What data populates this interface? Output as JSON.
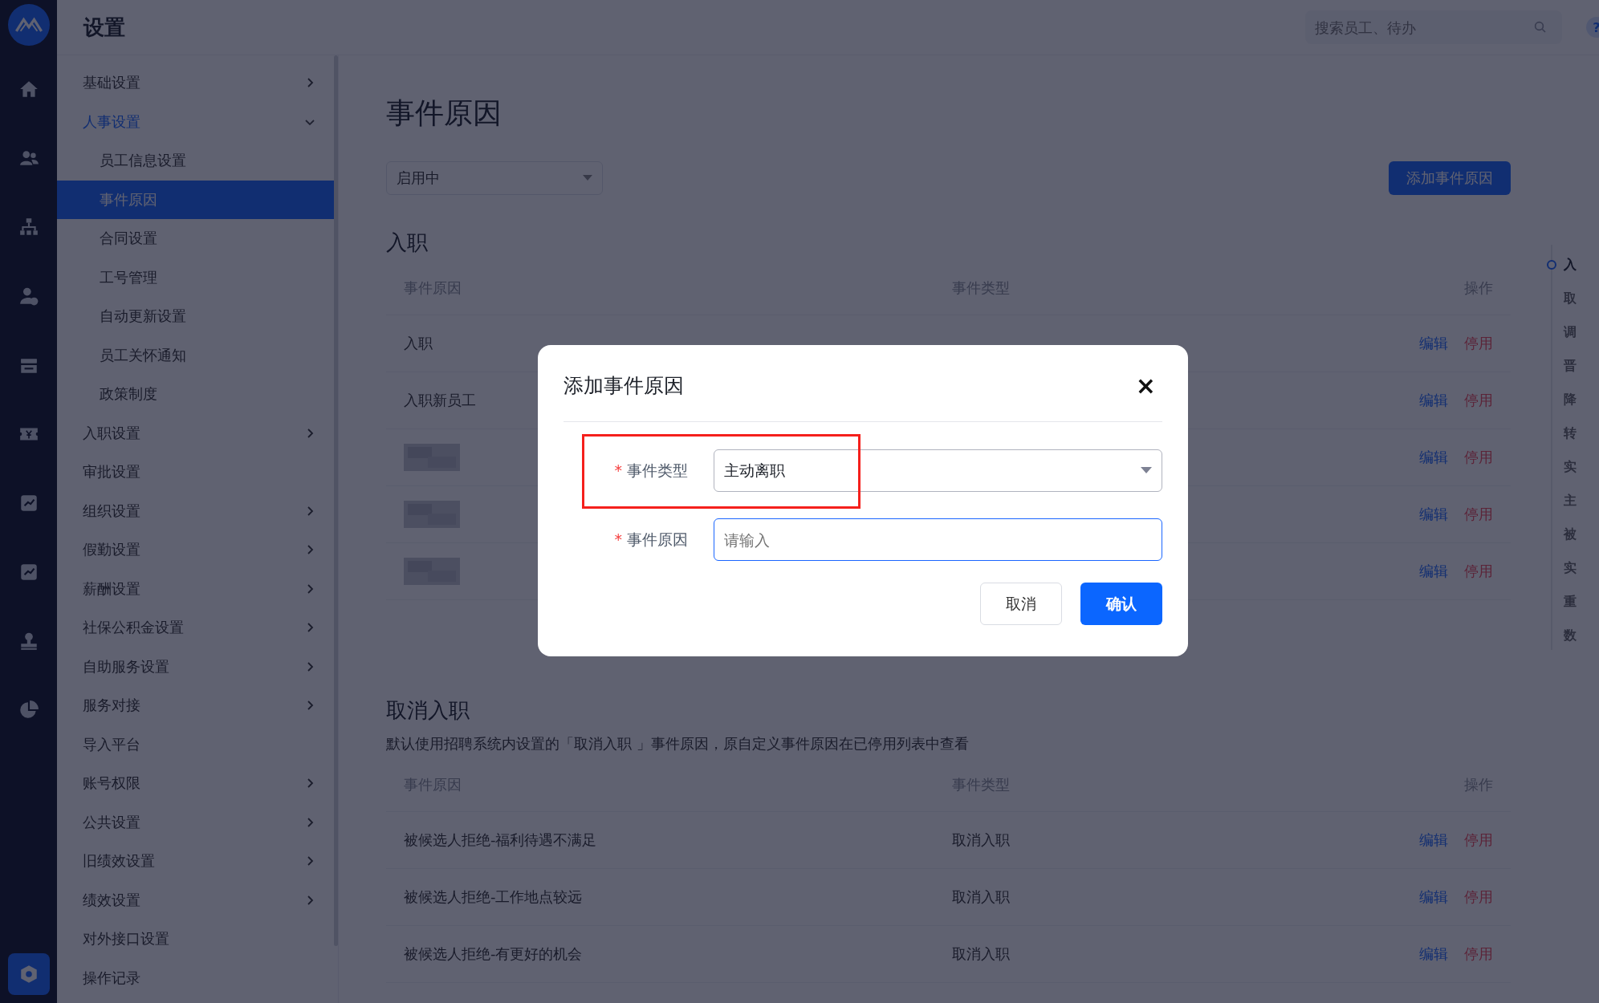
{
  "header": {
    "title": "设置",
    "search": {
      "placeholder": "搜索员工、待办"
    },
    "help": "?"
  },
  "rail": [
    {
      "kind": "home",
      "selected": false
    },
    {
      "kind": "people",
      "selected": false
    },
    {
      "kind": "org",
      "selected": false
    },
    {
      "kind": "user-add",
      "selected": false
    },
    {
      "kind": "calendar",
      "selected": false
    },
    {
      "kind": "ticket",
      "selected": false
    },
    {
      "kind": "chart",
      "selected": false
    },
    {
      "kind": "chart",
      "selected": false
    },
    {
      "kind": "stamp",
      "selected": false
    },
    {
      "kind": "pie",
      "selected": false
    },
    {
      "kind": "settings",
      "selected": true
    }
  ],
  "sidebar": {
    "items": [
      {
        "label": "基础设置",
        "expanded": false,
        "has_children": true,
        "selected": false
      },
      {
        "label": "人事设置",
        "expanded": true,
        "has_children": true,
        "selected": false,
        "children": [
          {
            "label": "员工信息设置",
            "selected": false
          },
          {
            "label": "事件原因",
            "selected": true
          },
          {
            "label": "合同设置",
            "selected": false
          },
          {
            "label": "工号管理",
            "selected": false
          },
          {
            "label": "自动更新设置",
            "selected": false
          },
          {
            "label": "员工关怀通知",
            "selected": false
          },
          {
            "label": "政策制度",
            "selected": false
          }
        ]
      },
      {
        "label": "入职设置",
        "expanded": false,
        "has_children": true,
        "selected": false
      },
      {
        "label": "审批设置",
        "expanded": false,
        "has_children": false,
        "selected": false
      },
      {
        "label": "组织设置",
        "expanded": false,
        "has_children": true,
        "selected": false
      },
      {
        "label": "假勤设置",
        "expanded": false,
        "has_children": true,
        "selected": false
      },
      {
        "label": "薪酬设置",
        "expanded": false,
        "has_children": true,
        "selected": false
      },
      {
        "label": "社保公积金设置",
        "expanded": false,
        "has_children": true,
        "selected": false
      },
      {
        "label": "自助服务设置",
        "expanded": false,
        "has_children": true,
        "selected": false
      },
      {
        "label": "服务对接",
        "expanded": false,
        "has_children": true,
        "selected": false
      },
      {
        "label": "导入平台",
        "expanded": false,
        "has_children": false,
        "selected": false
      },
      {
        "label": "账号权限",
        "expanded": false,
        "has_children": true,
        "selected": false
      },
      {
        "label": "公共设置",
        "expanded": false,
        "has_children": true,
        "selected": false
      },
      {
        "label": "旧绩效设置",
        "expanded": false,
        "has_children": true,
        "selected": false
      },
      {
        "label": "绩效设置",
        "expanded": false,
        "has_children": true,
        "selected": false
      },
      {
        "label": "对外接口设置",
        "expanded": false,
        "has_children": false,
        "selected": false
      },
      {
        "label": "操作记录",
        "expanded": false,
        "has_children": false,
        "selected": false
      }
    ]
  },
  "page": {
    "title": "事件原因",
    "status_filter": "启用中",
    "add_button": "添加事件原因"
  },
  "sections": [
    {
      "title": "入职",
      "columns": [
        "事件原因",
        "事件类型",
        "操作"
      ],
      "rows": [
        {
          "reason": "入职",
          "blurred": false,
          "actions": [
            "编辑",
            "停用"
          ]
        },
        {
          "reason": "入职新员工",
          "blurred": false,
          "actions": [
            "编辑",
            "停用"
          ]
        },
        {
          "blurred": true,
          "actions": [
            "编辑",
            "停用"
          ]
        },
        {
          "blurred": true,
          "actions": [
            "编辑",
            "停用"
          ]
        },
        {
          "blurred": true,
          "actions": [
            "编辑",
            "停用"
          ]
        }
      ]
    },
    {
      "title": "取消入职",
      "description": "默认使用招聘系统内设置的「取消入职 」事件原因，原自定义事件原因在已停用列表中查看",
      "columns": [
        "事件原因",
        "事件类型",
        "操作"
      ],
      "rows": [
        {
          "reason": "被候选人拒绝-福利待遇不满足",
          "type": "取消入职",
          "blurred": false,
          "actions": [
            "编辑",
            "停用"
          ]
        },
        {
          "reason": "被候选人拒绝-工作地点较远",
          "type": "取消入职",
          "blurred": false,
          "actions": [
            "编辑",
            "停用"
          ]
        },
        {
          "reason": "被候选人拒绝-有更好的机会",
          "type": "取消入职",
          "blurred": false,
          "actions": [
            "编辑",
            "停用"
          ]
        }
      ]
    }
  ],
  "anchors": [
    {
      "label": "入",
      "selected": true
    },
    {
      "label": "取",
      "selected": false
    },
    {
      "label": "调",
      "selected": false
    },
    {
      "label": "晋",
      "selected": false
    },
    {
      "label": "降",
      "selected": false
    },
    {
      "label": "转",
      "selected": false
    },
    {
      "label": "实",
      "selected": false
    },
    {
      "label": "主",
      "selected": false
    },
    {
      "label": "被",
      "selected": false
    },
    {
      "label": "实",
      "selected": false
    },
    {
      "label": "重",
      "selected": false
    },
    {
      "label": "数",
      "selected": false
    }
  ],
  "dialog": {
    "title": "添加事件原因",
    "close": "×",
    "fields": [
      {
        "label": "事件类型",
        "required_mark": "*",
        "kind": "select",
        "value": "主动离职",
        "highlighted": true
      },
      {
        "label": "事件原因",
        "required_mark": "*",
        "kind": "input",
        "placeholder": "请输入",
        "highlighted": false
      }
    ],
    "buttons": [
      {
        "label": "取消",
        "kind": "secondary"
      },
      {
        "label": "确认",
        "kind": "primary"
      }
    ]
  }
}
